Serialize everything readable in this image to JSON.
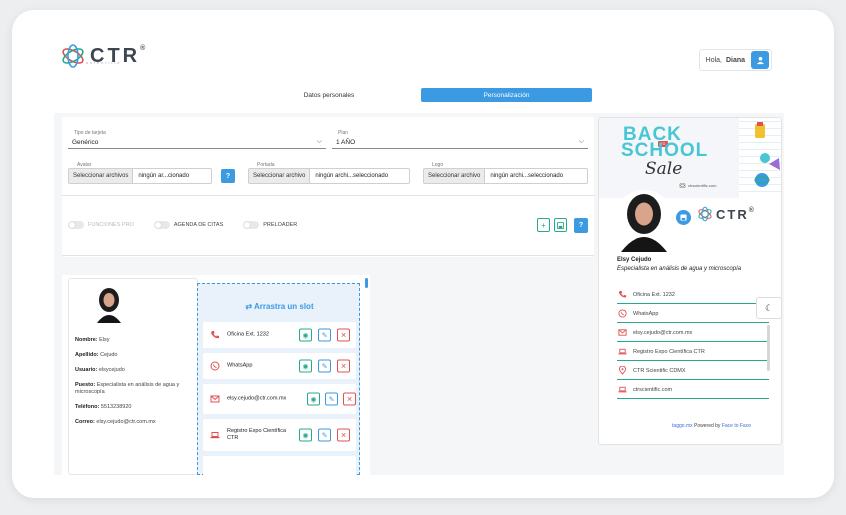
{
  "header": {
    "brand": "CTR",
    "brand_reg": "®",
    "brand_tag": "scientific",
    "greeting_prefix": "Hola,",
    "user_name": "Diana"
  },
  "tabs": [
    {
      "label": "Datos personales",
      "active": false
    },
    {
      "label": "Personalización",
      "active": true
    }
  ],
  "form": {
    "card_type_label": "Tipo de tarjeta",
    "card_type_value": "Genérico",
    "plan_label": "Plan",
    "plan_value": "1 AÑO",
    "avatar_label": "Avatar",
    "avatar_button": "Seleccionar archivos",
    "avatar_file": "ningún ar...cionado",
    "cover_label": "Portada",
    "cover_button": "Seleccionar archivo",
    "cover_file": "ningún archi...seleccionado",
    "logo_label": "Logo",
    "logo_button": "Seleccionar archivo",
    "logo_file": "ningún archi...seleccionado",
    "help": "?"
  },
  "toggles": [
    {
      "label": "FUNCIONES PRO",
      "enabled": false
    },
    {
      "label": "AGENDA DE CITAS",
      "enabled": true
    },
    {
      "label": "PRELOADER",
      "enabled": true
    }
  ],
  "actions": {
    "add": "+",
    "help": "?"
  },
  "profile": {
    "name_label": "Nombre:",
    "name": "Elsy",
    "last_label": "Apellido:",
    "last": "Cejudo",
    "user_label": "Usuario:",
    "user": "elsycejudo",
    "role_label": "Puesto:",
    "role": "Especialista en análisis de agua y microscopía",
    "phone_label": "Teléfono:",
    "phone": "5513238920",
    "email_label": "Correo:",
    "email": "elsy.cejudo@ctr.com.mx"
  },
  "slots": {
    "title": "Arrastra un slot",
    "items": [
      {
        "label": "Oficina Ext. 1232",
        "icon": "phone-icon"
      },
      {
        "label": "WhatsApp",
        "icon": "whatsapp-icon"
      },
      {
        "label": "elsy.cejudo@ctr.com.mx",
        "icon": "mail-icon"
      },
      {
        "label": "Registro Expo Científica CTR",
        "icon": "laptop-icon"
      }
    ]
  },
  "preview": {
    "banner_line1": "BACK",
    "banner_badge": "TO",
    "banner_line2": "SCHOOL",
    "banner_line3": "Sale",
    "banner_site": "ctrscientific.com",
    "brand": "CTR",
    "brand_reg": "®",
    "name": "Elsy Cejudo",
    "title": "Especialista en análisis de agua y microscopía",
    "items": [
      {
        "label": "Oficina Ext. 1232"
      },
      {
        "label": "WhatsApp"
      },
      {
        "label": "elsy.cejudo@ctr.com.mx"
      },
      {
        "label": "Registro Expo Científica CTR"
      },
      {
        "label": "CTR Scientific CDMX"
      },
      {
        "label": "ctrscientific.com"
      }
    ],
    "footer_link1": "taggo.mx",
    "footer_text": "Powered by",
    "footer_link2": "Face to Face"
  },
  "colors": {
    "accent": "#3b9ae1",
    "success": "#2aa98a",
    "danger": "#e15050"
  }
}
